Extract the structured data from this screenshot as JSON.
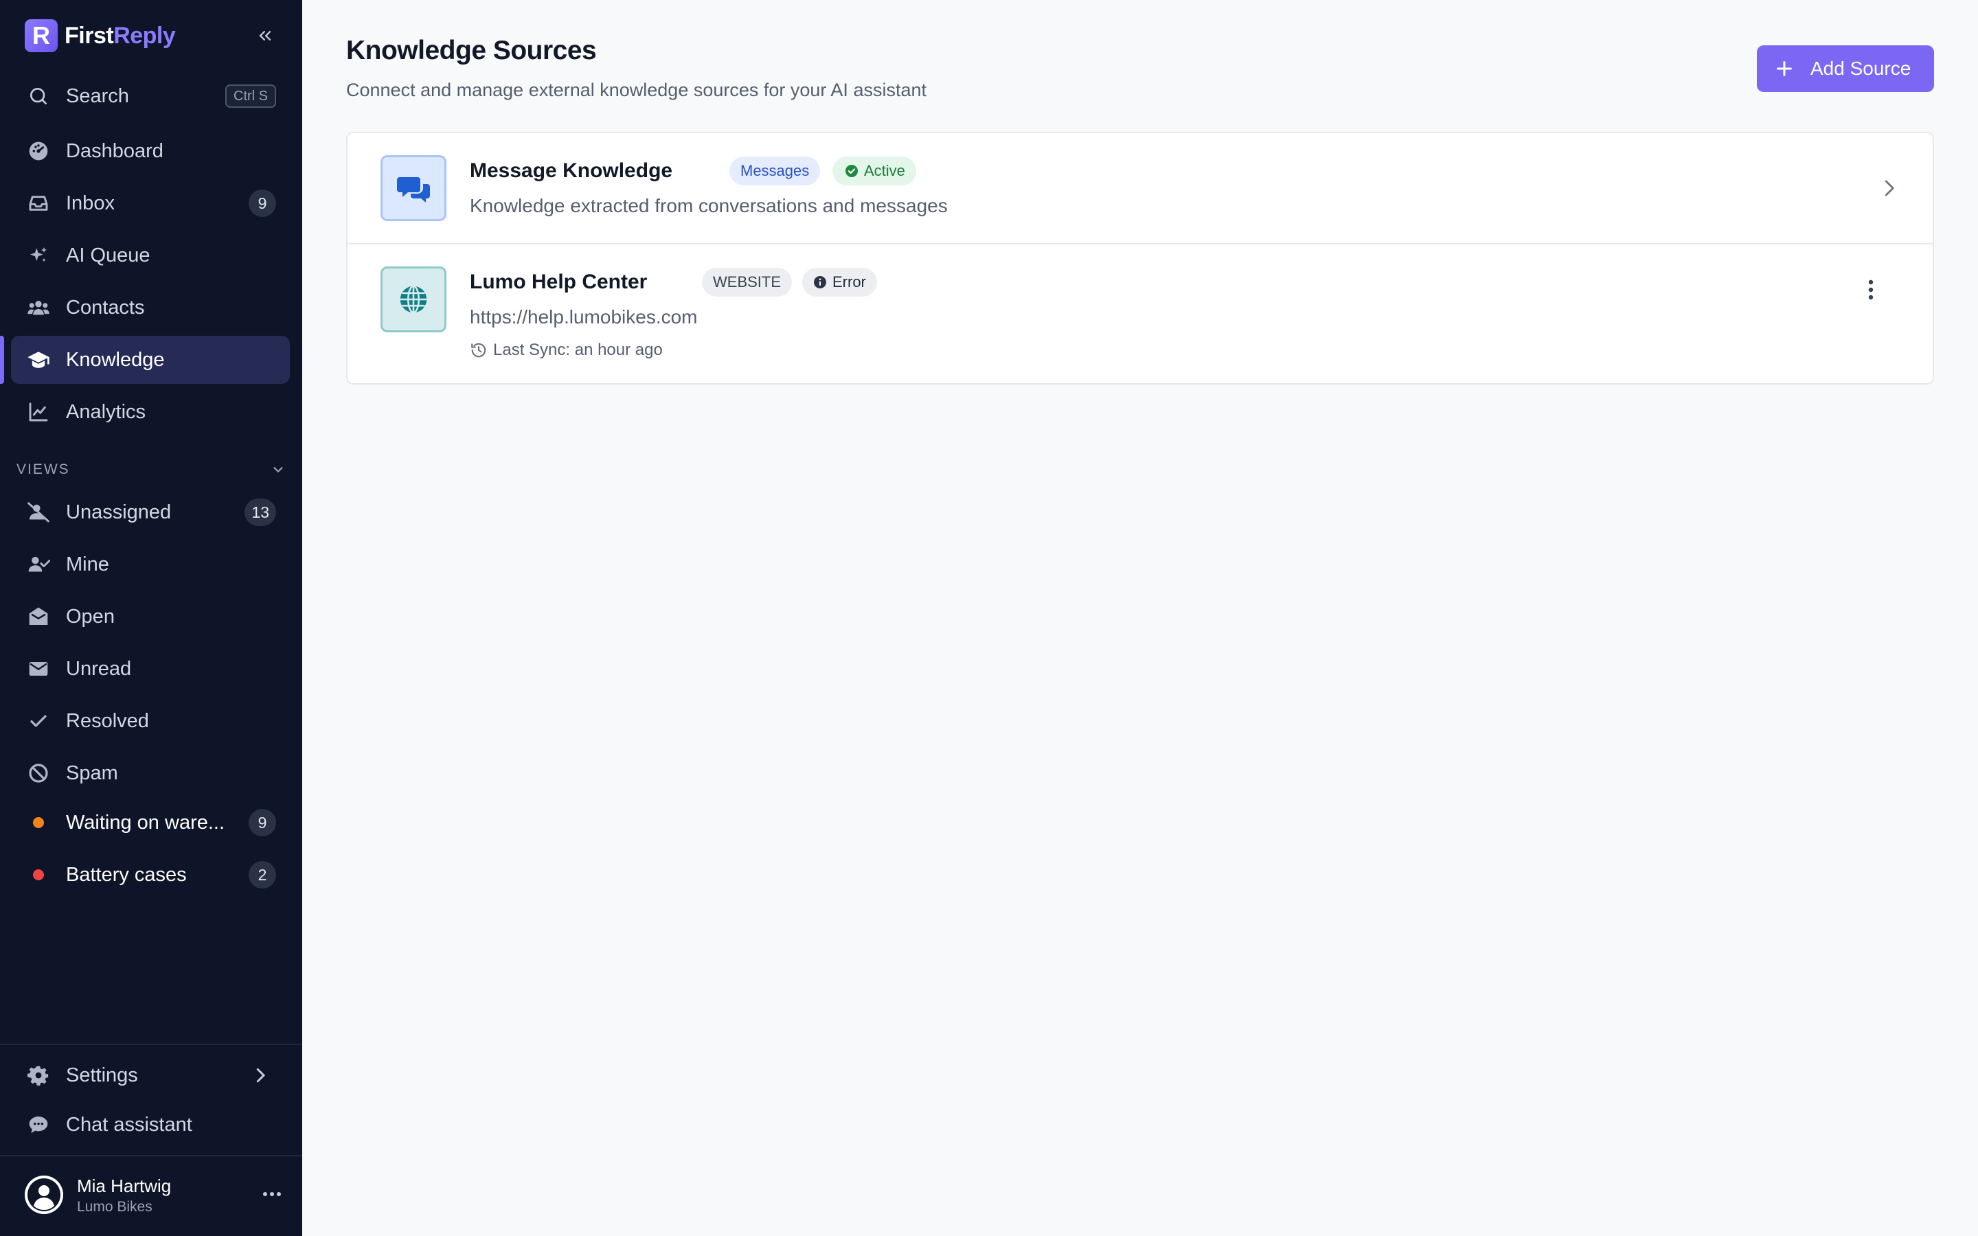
{
  "brand": {
    "first": "First",
    "reply": "Reply",
    "logo_letter": "R"
  },
  "search": {
    "label": "Search",
    "shortcut": "Ctrl S"
  },
  "nav": [
    {
      "label": "Dashboard",
      "icon": "dashboard-icon"
    },
    {
      "label": "Inbox",
      "icon": "inbox-icon",
      "count": "9"
    },
    {
      "label": "AI Queue",
      "icon": "sparkles-icon"
    },
    {
      "label": "Contacts",
      "icon": "contacts-icon"
    },
    {
      "label": "Knowledge",
      "icon": "graduation-cap-icon",
      "active": true
    },
    {
      "label": "Analytics",
      "icon": "analytics-icon"
    }
  ],
  "views": {
    "header": "VIEWS",
    "items": [
      {
        "label": "Unassigned",
        "icon": "user-slash-icon",
        "count": "13"
      },
      {
        "label": "Mine",
        "icon": "user-check-icon"
      },
      {
        "label": "Open",
        "icon": "envelope-open-icon"
      },
      {
        "label": "Unread",
        "icon": "envelope-icon"
      },
      {
        "label": "Resolved",
        "icon": "check-icon"
      },
      {
        "label": "Spam",
        "icon": "ban-icon"
      },
      {
        "label": "Waiting on ware...",
        "dot_color": "#f5821f",
        "count": "9"
      },
      {
        "label": "Battery cases",
        "dot_color": "#ef4444",
        "count": "2"
      }
    ]
  },
  "footer": {
    "settings": "Settings",
    "chat_assistant": "Chat assistant",
    "user_name": "Mia Hartwig",
    "user_org": "Lumo Bikes"
  },
  "page": {
    "title": "Knowledge Sources",
    "subtitle": "Connect and manage external knowledge sources for your AI assistant",
    "add_button": "Add Source"
  },
  "sources": [
    {
      "title": "Message Knowledge",
      "type_badge": "Messages",
      "status": "Active",
      "description": "Knowledge extracted from conversations and messages",
      "icon": "chat-bubbles-icon"
    },
    {
      "title": "Lumo Help Center",
      "type_badge": "WEBSITE",
      "status": "Error",
      "description": "https://help.lumobikes.com",
      "last_sync": "Last Sync: an hour ago",
      "icon": "globe-icon"
    }
  ],
  "colors": {
    "sidebar_bg": "#0e1529",
    "accent": "#7c67f5",
    "active_item_bg": "#262b55",
    "status_active": "#1d7a3a",
    "status_error": "#1f2937"
  }
}
